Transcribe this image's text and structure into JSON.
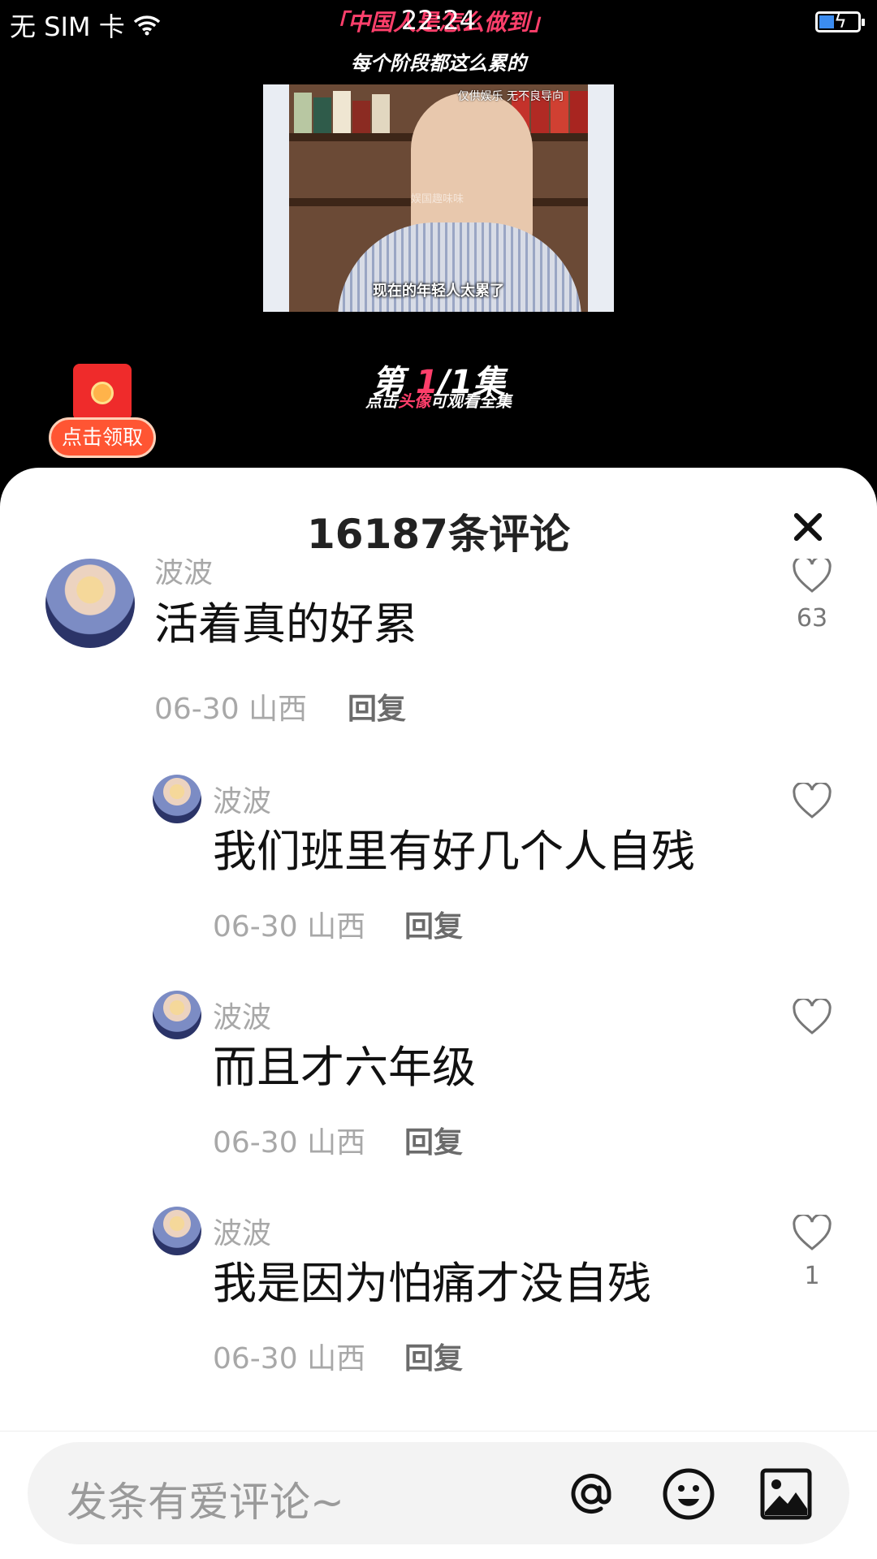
{
  "status_bar": {
    "carrier": "无 SIM 卡",
    "time": "22:24"
  },
  "video": {
    "headline": "「中国人是怎么做到」",
    "subtitle": "每个阶段都这么累的",
    "thumb_tag": "仅供娱乐  无不良导向",
    "thumb_watermark": "娱国趣味味",
    "thumb_caption": "现在的年轻人太累了",
    "episode_prefix": "第 ",
    "episode_current": "1",
    "episode_suffix": "/1集",
    "episode_hint_pre": "点击",
    "episode_hint_hl": "头像",
    "episode_hint_post": "可观看全集",
    "redpack_label": "点击领取"
  },
  "comments_panel": {
    "title": "16187条评论",
    "input_placeholder": "发条有爱评论~",
    "items": [
      {
        "name": "波波",
        "text": "活着真的好累",
        "date": "06-30",
        "location": "山西",
        "reply": "回复",
        "likes": "63"
      },
      {
        "name": "波波",
        "text": "我们班里有好几个人自残",
        "date": "06-30",
        "location": "山西",
        "reply": "回复",
        "likes": ""
      },
      {
        "name": "波波",
        "text": "而且才六年级",
        "date": "06-30",
        "location": "山西",
        "reply": "回复",
        "likes": ""
      },
      {
        "name": "波波",
        "text": "我是因为怕痛才没自残",
        "date": "06-30",
        "location": "山西",
        "reply": "回复",
        "likes": "1"
      }
    ]
  },
  "icons": {
    "wifi": "wifi-icon",
    "battery": "battery-charging-icon",
    "close": "close-icon",
    "like": "heart-outline-icon",
    "mention": "at-icon",
    "emoji": "smile-icon",
    "image": "image-icon"
  },
  "colors": {
    "accent": "#ff3f6b",
    "redpack": "#ff5533",
    "battery": "#3b8cf0"
  }
}
